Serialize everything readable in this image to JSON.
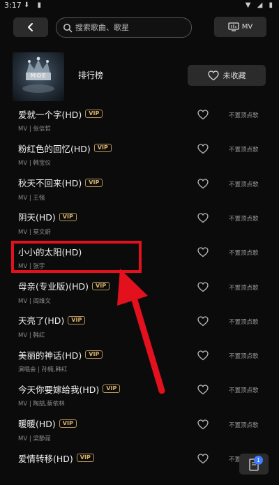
{
  "status_bar": {
    "time": "3:17"
  },
  "header": {
    "search_placeholder": "搜索歌曲、歌星",
    "mv_label": "MV"
  },
  "playlist": {
    "title": "排行榜",
    "cover_text": "MOE",
    "fav_label": "未收藏"
  },
  "songs": [
    {
      "title": "爱就一个字(HD)",
      "vip": "VIP",
      "meta": "MV | 张信哲",
      "pin": "不置顶点歌"
    },
    {
      "title": "粉红色的回忆(HD)",
      "vip": "VIP",
      "meta": "MV | 韩宝仪",
      "pin": "不置顶点歌"
    },
    {
      "title": "秋天不回来(HD)",
      "vip": "VIP",
      "meta": "MV | 王强",
      "pin": "不置顶点歌"
    },
    {
      "title": "阴天(HD)",
      "vip": "VIP",
      "meta": "MV | 莫文蔚",
      "pin": "不置顶点歌"
    },
    {
      "title": "小小的太阳(HD)",
      "vip": "",
      "meta": "MV | 张宇",
      "pin": "不置顶点歌"
    },
    {
      "title": "母亲(专业版)(HD)",
      "vip": "VIP",
      "meta": "MV | 阎维文",
      "pin": "不置顶点歌"
    },
    {
      "title": "天亮了(HD)",
      "vip": "VIP",
      "meta": "MV | 韩红",
      "pin": "不置顶点歌"
    },
    {
      "title": "美丽的神话(HD)",
      "vip": "VIP",
      "meta": "演唱会 | 孙楠,韩红",
      "pin": "不置顶点歌"
    },
    {
      "title": "今天你要嫁给我(HD)",
      "vip": "VIP",
      "meta": "MV | 陶喆,蔡依林",
      "pin": "不置顶点歌"
    },
    {
      "title": "暖暖(HD)",
      "vip": "VIP",
      "meta": "MV | 梁静茹",
      "pin": "不置顶点歌"
    },
    {
      "title": "爱情转移(HD)",
      "vip": "VIP",
      "meta": "",
      "pin": "不置顶点歌"
    }
  ],
  "queue_badge": "1",
  "colors": {
    "accent_red": "#e3101d",
    "vip_gold": "#d9b46c",
    "badge_blue": "#3d7dff"
  }
}
